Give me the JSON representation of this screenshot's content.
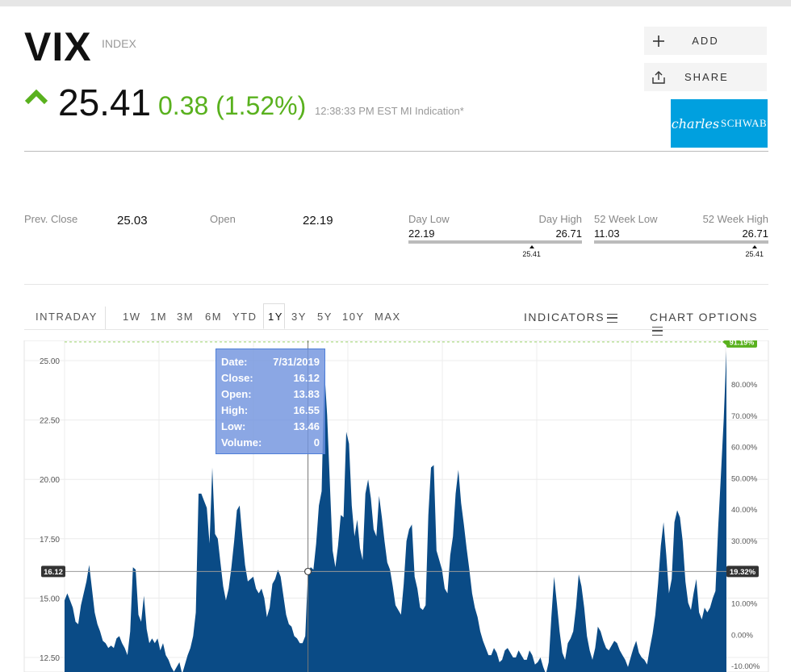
{
  "header": {
    "symbol": "VIX",
    "type": "INDEX",
    "price": "25.41",
    "change": "0.38 (1.52%)",
    "timestamp": "12:38:33 PM EST MI Indication*",
    "add_label": "ADD",
    "share_label": "SHARE",
    "sponsor": {
      "script": "charles",
      "caps": "SCHWAB"
    },
    "up_color": "#59b11e",
    "sponsor_color": "#00a0df"
  },
  "stats": {
    "prev_close_label": "Prev. Close",
    "prev_close": "25.03",
    "open_label": "Open",
    "open": "22.19",
    "day": {
      "low_label": "Day Low",
      "high_label": "Day High",
      "low": "22.19",
      "high": "26.71",
      "current": "25.41",
      "position": 0.71
    },
    "week52": {
      "low_label": "52 Week Low",
      "high_label": "52 Week High",
      "low": "11.03",
      "high": "26.71",
      "current": "25.41",
      "position": 0.92
    }
  },
  "timeframes": {
    "intraday": "INTRADAY",
    "items": [
      "1W",
      "1M",
      "3M",
      "6M",
      "YTD",
      "1Y",
      "3Y",
      "5Y",
      "10Y",
      "MAX"
    ],
    "active": "1Y",
    "indicators": "INDICATORS",
    "chart_options": "CHART OPTIONS"
  },
  "tooltip": {
    "date_label": "Date:",
    "date": "7/31/2019",
    "close_label": "Close:",
    "close": "16.12",
    "open_label": "Open:",
    "open": "13.83",
    "high_label": "High:",
    "high": "16.55",
    "low_label": "Low:",
    "low": "13.46",
    "volume_label": "Volume:",
    "volume": "0"
  },
  "chart_data": {
    "type": "area",
    "series_color": "#0a4b86",
    "y_left_ticks": [
      "25.00",
      "22.50",
      "20.00",
      "17.50",
      "15.00",
      "12.50"
    ],
    "y_left_tick_values": [
      25,
      22.5,
      20,
      17.5,
      15,
      12.5
    ],
    "y_right_ticks": [
      "80.00%",
      "70.00%",
      "60.00%",
      "50.00%",
      "40.00%",
      "30.00%",
      "20.00%",
      "10.00%",
      "0.00%",
      "-10.00%"
    ],
    "y_right_tick_values": [
      80,
      70,
      60,
      50,
      40,
      30,
      20,
      10,
      0,
      -10
    ],
    "ylim": [
      11.7,
      26.0
    ],
    "crosshair_value": "16.12",
    "crosshair_pct": "19.32%",
    "last_pct": "91.19%",
    "last_value": 25.41,
    "crosshair_index": 89,
    "values": [
      14.9,
      15.2,
      14.9,
      14.6,
      14.0,
      13.9,
      14.7,
      15.2,
      15.7,
      16.4,
      15.4,
      14.4,
      13.9,
      13.6,
      13.2,
      13.1,
      12.9,
      13.0,
      12.9,
      13.3,
      13.4,
      13.1,
      12.9,
      12.6,
      13.6,
      16.3,
      16.2,
      14.3,
      14.0,
      15.1,
      13.7,
      13.1,
      13.3,
      13.1,
      13.3,
      12.8,
      13.1,
      12.6,
      12.4,
      12.1,
      11.9,
      12.1,
      12.3,
      11.8,
      12.2,
      12.6,
      12.9,
      13.4,
      14.4,
      19.4,
      19.4,
      19.1,
      18.8,
      17.3,
      20.5,
      17.7,
      17.5,
      16.5,
      15.5,
      14.9,
      15.4,
      16.3,
      17.4,
      18.7,
      18.9,
      17.6,
      16.4,
      15.7,
      15.8,
      15.9,
      15.4,
      15.2,
      15.4,
      15.0,
      14.2,
      14.6,
      15.6,
      15.8,
      16.2,
      15.9,
      15.1,
      14.3,
      13.9,
      13.8,
      13.4,
      13.3,
      13.1,
      13.1,
      13.4,
      16.1,
      16.3,
      16.2,
      17.3,
      18.9,
      19.5,
      24.6,
      22.7,
      19.8,
      17.0,
      16.3,
      17.2,
      18.5,
      18.4,
      22.0,
      21.5,
      18.9,
      17.6,
      18.3,
      17.1,
      16.6,
      19.4,
      20.0,
      19.2,
      17.9,
      17.6,
      19.3,
      18.4,
      17.4,
      16.5,
      16.2,
      15.5,
      14.7,
      14.5,
      14.3,
      15.6,
      17.4,
      17.9,
      18.1,
      15.9,
      15.4,
      14.6,
      14.5,
      14.7,
      18.5,
      20.5,
      20.6,
      17.0,
      16.6,
      16.2,
      15.4,
      15.2,
      16.8,
      17.6,
      19.4,
      20.4,
      19.0,
      18.1,
      17.1,
      16.2,
      15.2,
      14.6,
      14.2,
      13.6,
      13.2,
      12.9,
      12.6,
      12.6,
      12.9,
      12.7,
      12.3,
      12.4,
      12.8,
      12.9,
      12.7,
      12.5,
      12.5,
      12.8,
      12.6,
      12.4,
      12.4,
      12.8,
      12.6,
      12.2,
      12.3,
      12.5,
      12.1,
      11.8,
      12.3,
      14.2,
      15.9,
      14.8,
      13.6,
      12.7,
      12.4,
      13.1,
      13.3,
      13.6,
      14.6,
      16.0,
      15.5,
      14.6,
      13.4,
      12.8,
      12.4,
      12.9,
      13.8,
      13.6,
      13.2,
      12.9,
      12.8,
      13.0,
      13.2,
      13.1,
      12.8,
      12.6,
      12.4,
      12.1,
      12.5,
      12.9,
      13.2,
      12.7,
      12.5,
      12.4,
      12.2,
      12.9,
      13.5,
      14.3,
      15.6,
      17.2,
      18.2,
      16.8,
      15.2,
      15.8,
      18.2,
      18.7,
      18.4,
      17.4,
      15.7,
      14.8,
      14.5,
      15.2,
      15.8,
      14.4,
      14.1,
      14.6,
      14.4,
      14.6,
      15.0,
      15.3,
      18.0,
      20.2,
      22.5,
      25.41
    ]
  }
}
